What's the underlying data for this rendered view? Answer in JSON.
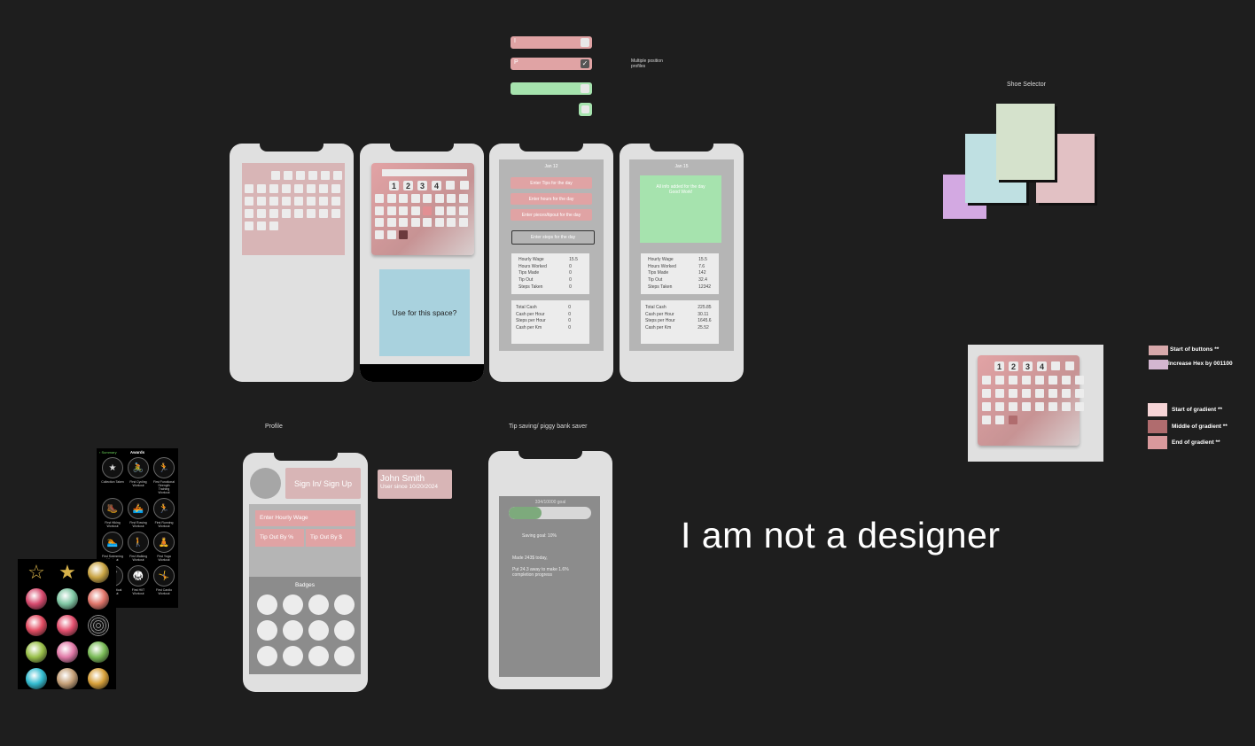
{
  "canvas": {
    "bg": "#1e1e1e"
  },
  "colors": {
    "pink": "#e0a3a4",
    "green": "#a6e3ae",
    "blue": "#a9d2de",
    "dark_cal": "#6b3a3d",
    "calendar_bg": "#d9b7b8"
  },
  "top_bars": {
    "bar1_text": "I",
    "bar2_text": "P",
    "note": "Multiple position profiles"
  },
  "shoe": {
    "title": "Shoe Selector",
    "colors": [
      "#d3a9e2",
      "#bfe0e2",
      "#d5e2cc",
      "#e2c1c4"
    ]
  },
  "phone2": {
    "weekdays": [
      "1",
      "2",
      "3",
      "4"
    ],
    "use_space": "Use for this space?"
  },
  "phone3": {
    "date": "Jan 12",
    "buttons": [
      "Enter Tips for the day",
      "Enter hours for the day",
      "Enter pieces/tipout for the day"
    ],
    "steps_button": "Enter steps for the day",
    "stats1": [
      [
        "Hourly Wage",
        "15.5"
      ],
      [
        "Hours Worked",
        "0"
      ],
      [
        "Tips Made",
        "0"
      ],
      [
        "Tip Out",
        "0"
      ],
      [
        "Steps Taken",
        "0"
      ]
    ],
    "stats2": [
      [
        "Total Cash",
        "0"
      ],
      [
        "Cash per Hour",
        "0"
      ],
      [
        "Steps per Hour",
        "0"
      ],
      [
        "Cash per Km",
        "0"
      ]
    ]
  },
  "phone4": {
    "date": "Jan 15",
    "done": "All info added for the day Good Work!",
    "stats1": [
      [
        "Hourly Wage",
        "15.5"
      ],
      [
        "Hours Worked",
        "7.6"
      ],
      [
        "Tips Made",
        "142"
      ],
      [
        "Tip Out",
        "32.4"
      ],
      [
        "Steps Taken",
        "12342"
      ]
    ],
    "stats2": [
      [
        "Total Cash",
        "225.85"
      ],
      [
        "Cash per Hour",
        "30.11"
      ],
      [
        "Steps per Hour",
        "1645.6"
      ],
      [
        "Cash per Km",
        "25.52"
      ]
    ]
  },
  "legend": [
    {
      "label": "Start of buttons **",
      "color": "#d7a8aa"
    },
    {
      "label": "Increase Hex by 001100",
      "color": "#d3b6d0"
    },
    {
      "label": "Start of gradient **",
      "color": "#f6d4d6"
    },
    {
      "label": "Middle of gradient **",
      "color": "#b06c6e"
    },
    {
      "label": "End of gradient **",
      "color": "#d9999c"
    }
  ],
  "profile": {
    "title": "Profile",
    "signin": "Sign In/ Sign Up",
    "name": "John Smith",
    "since": "User since 10/20/2024",
    "wage_placeholder": "Enter Hourly Wage",
    "tip_pct": "Tip Out By %",
    "tip_dollar": "Tip Out By $",
    "badges": "Badges"
  },
  "tip": {
    "title": "Tip saving/ piggy bank saver",
    "goal": "334/10000 goal",
    "progress": 0.4,
    "saving_goal": "Saving goal: 10%",
    "made": "Made 243$ today,",
    "put": "Put 24.3 away to make 1.6% completion progress"
  },
  "awards": {
    "back": "Summary",
    "title": "Awards",
    "items": [
      {
        "icon": "★",
        "cap": "Collection Taken"
      },
      {
        "icon": "🚴",
        "cap": "First Cycling Workout"
      },
      {
        "icon": "🏃",
        "cap": "First Functional Strength Training Workout"
      },
      {
        "icon": "🥾",
        "cap": "First Hiking Workout"
      },
      {
        "icon": "🚣",
        "cap": "First Rowing Workout"
      },
      {
        "icon": "🏃",
        "cap": "First Running Workout"
      },
      {
        "icon": "🏊",
        "cap": "First Swimming Workout"
      },
      {
        "icon": "🚶",
        "cap": "First Walking Workout"
      },
      {
        "icon": "🧘",
        "cap": "First Yoga Workout"
      },
      {
        "icon": "🏋",
        "cap": "First Elliptical Workout"
      },
      {
        "icon": "🥋",
        "cap": "First HIIT Workout"
      },
      {
        "icon": "🤸",
        "cap": "First Cardio Workout"
      }
    ]
  },
  "medals": [
    "#1a1a1a",
    "#d7b24a",
    "#c9a443",
    "#d74a6e",
    "#7fc6a3",
    "#e0756a",
    "#e24c62",
    "#e34f6e",
    "#222222",
    "#9ac04a",
    "#e17aa8",
    "#7abb57",
    "#33bcd0",
    "#c5a078",
    "#d7a03a"
  ],
  "tagline": "I am not a designer"
}
